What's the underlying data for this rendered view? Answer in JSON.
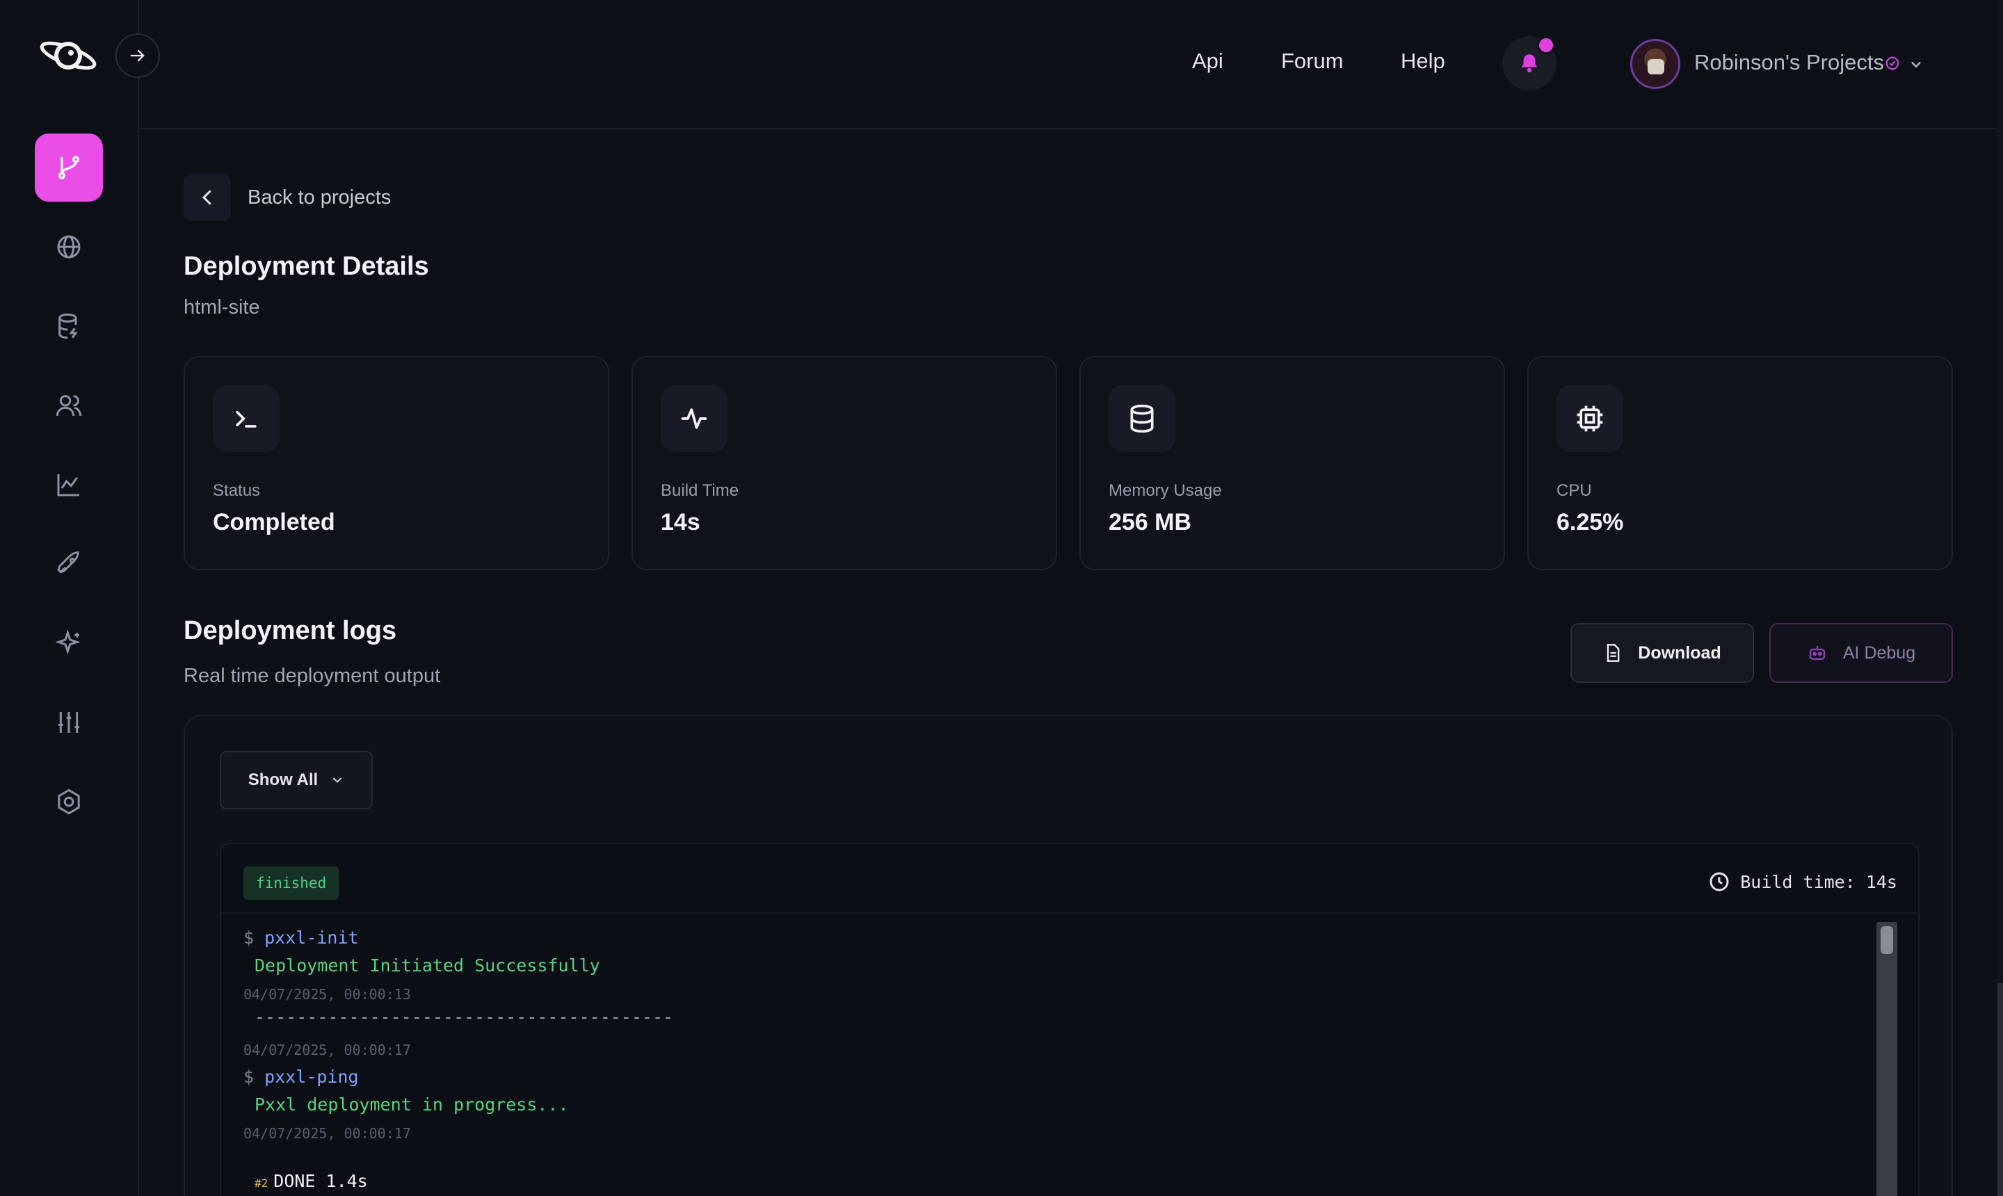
{
  "header": {
    "links": [
      "Api",
      "Forum",
      "Help"
    ],
    "project_name": "Robinson's Projects"
  },
  "sidebar": {
    "items": [
      {
        "icon": "git-branch-icon",
        "active": true
      },
      {
        "icon": "globe-icon"
      },
      {
        "icon": "database-icon"
      },
      {
        "icon": "users-icon"
      },
      {
        "icon": "chart-icon"
      },
      {
        "icon": "rocket-icon"
      },
      {
        "icon": "sparkle-icon"
      },
      {
        "icon": "sliders-icon"
      },
      {
        "icon": "settings-icon"
      }
    ]
  },
  "back_label": "Back to projects",
  "page_title": "Deployment Details",
  "page_subtitle": "html-site",
  "stats": [
    {
      "label": "Status",
      "value": "Completed",
      "icon": "terminal-icon"
    },
    {
      "label": "Build Time",
      "value": "14s",
      "icon": "activity-icon"
    },
    {
      "label": "Memory Usage",
      "value": "256 MB",
      "icon": "database-icon"
    },
    {
      "label": "CPU",
      "value": "6.25%",
      "icon": "cpu-icon"
    }
  ],
  "logs": {
    "title": "Deployment logs",
    "subtitle": "Real time deployment output",
    "download_label": "Download",
    "ai_debug_label": "AI Debug",
    "filter_label": "Show All",
    "status_badge": "finished",
    "build_time": "Build time: 14s",
    "lines": {
      "l1_prompt": "$",
      "l1_cmd": "pxxl-init",
      "l2": "Deployment Initiated Successfully",
      "l3": "04/07/2025, 00:00:13",
      "l4": "----------------------------------------",
      "l5": "04/07/2025, 00:00:17",
      "l6_prompt": "$",
      "l6_cmd": "pxxl-ping",
      "l7": "Pxxl deployment in progress...",
      "l8": "04/07/2025, 00:00:17",
      "l9_step": "#2",
      "l9": "DONE 1.4s"
    }
  },
  "colors": {
    "accent": "#ea4ee6",
    "background": "#0d0f17",
    "success": "#58d47e",
    "command": "#7fa2ff"
  }
}
